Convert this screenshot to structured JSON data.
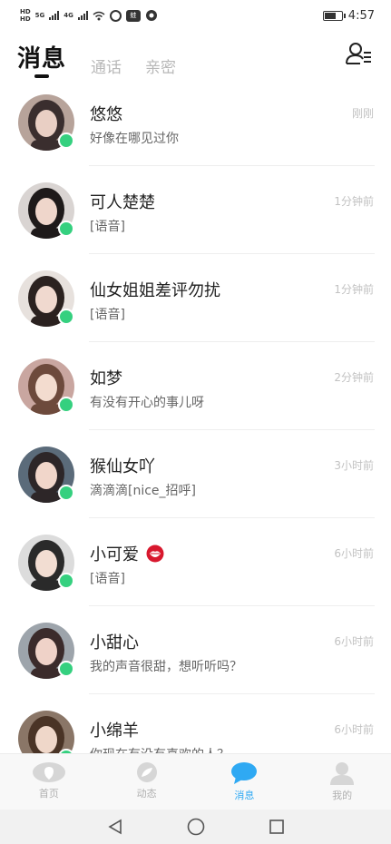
{
  "status_bar": {
    "sim1": "HD",
    "sim2": "HD",
    "net1": "5G",
    "net2": "4G",
    "app_badge": "蛙",
    "time": "4:57",
    "battery_level": 0.7
  },
  "header": {
    "tab_messages": "消息",
    "tab_calls": "通话",
    "tab_intimate": "亲密",
    "contacts_icon": "contacts-icon"
  },
  "chats": [
    {
      "name": "悠悠",
      "preview": "好像在哪见过你",
      "time": "刚刚",
      "online": true
    },
    {
      "name": "可人楚楚",
      "preview": "[语音]",
      "time": "1分钟前",
      "online": true
    },
    {
      "name": "仙女姐姐差评勿扰",
      "preview": "[语音]",
      "time": "1分钟前",
      "online": true
    },
    {
      "name": "如梦",
      "preview": "有没有开心的事儿呀",
      "time": "2分钟前",
      "online": true
    },
    {
      "name": "猴仙女吖",
      "preview": "滴滴滴[nice_招呼]",
      "time": "3小时前",
      "online": true
    },
    {
      "name": "小可爱",
      "preview": "[语音]",
      "time": "6小时前",
      "online": true,
      "emoji": "lips-icon"
    },
    {
      "name": "小甜心",
      "preview": "我的声音很甜，想听听吗？",
      "time": "6小时前",
      "online": true
    },
    {
      "name": "小绵羊",
      "preview": "你现在有没有喜欢的人？",
      "time": "6小时前",
      "online": true
    }
  ],
  "tabbar": {
    "home": "首页",
    "moments": "动态",
    "messages": "消息",
    "mine": "我的",
    "active_color": "#2fa9f3",
    "inactive_color": "#b0b0b0"
  },
  "colors": {
    "online": "#35d07f",
    "time": "#c2c2c2"
  }
}
